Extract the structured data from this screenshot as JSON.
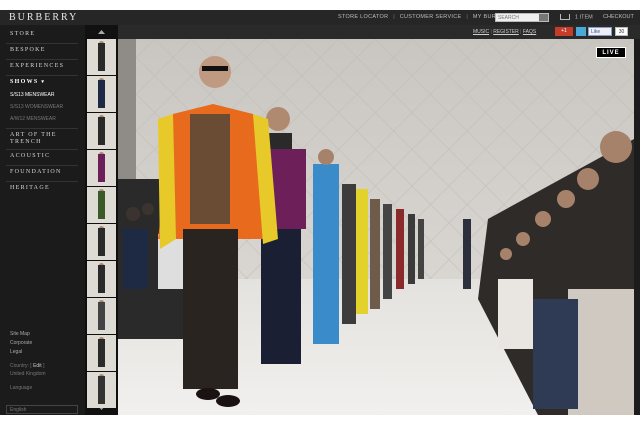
{
  "brand": {
    "logo": "BURBERRY"
  },
  "topbar": {
    "links": [
      "STORE LOCATOR",
      "CUSTOMER SERVICE",
      "MY BURBERRY"
    ],
    "separator": "|",
    "search_placeholder": "SEARCH",
    "cart_label": "1 ITEM",
    "checkout_label": "CHECKOUT"
  },
  "subbar": {
    "music": "MUSIC",
    "register": "REGISTER",
    "faqs": "FAQS",
    "gplus": "+1",
    "fb_like": "Like",
    "fb_count": "30"
  },
  "sidebar": {
    "nav": [
      "STORE",
      "BESPOKE",
      "EXPERIENCES",
      "SHOWS",
      "ART OF THE TRENCH",
      "ACOUSTIC",
      "FOUNDATION",
      "HERITAGE"
    ],
    "shows_chevron": "▾",
    "shows_sub": [
      "S/S13 MENSWEAR",
      "S/S13 WOMENSWEAR",
      "A/W12 MENSWEAR"
    ],
    "footer": [
      "Site Map",
      "Corporate",
      "Legal"
    ],
    "country_label": "Country: [",
    "country_edit": "Edit",
    "country_close": "]",
    "country_value": "United Kingdom",
    "language_label": "Language",
    "language_value": "English"
  },
  "stage": {
    "live_badge": "LIVE"
  },
  "colors": {
    "frame": "#1c1c1c",
    "accent_orange": "#e86a1c",
    "accent_yellow": "#e8c92a",
    "purple": "#6d1f5a",
    "blue": "#3a8bc9"
  }
}
